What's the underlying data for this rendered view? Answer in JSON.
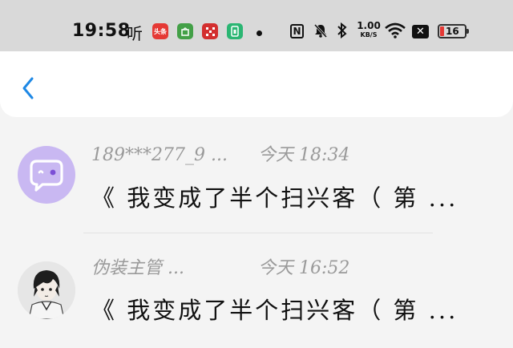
{
  "status_bar": {
    "time": "19:58",
    "ting_glyph": "听",
    "app_badge_1": "头条",
    "net_speed_value": "1.00",
    "net_speed_unit": "KB/S",
    "nfc": "N",
    "battery_level": "16",
    "icons": [
      "toutiao-icon",
      "shop-icon",
      "grid-app-icon",
      "sim-app-icon",
      "dot-icon",
      "nfc-icon",
      "mute-bell-icon",
      "bluetooth-icon",
      "wifi-icon",
      "close-box-icon",
      "battery-icon"
    ],
    "colors": {
      "battery_low": "#e53935",
      "accent": "#1e88e5"
    }
  },
  "header": {
    "back_icon": "chevron-left-icon"
  },
  "items": [
    {
      "name": "189***277_9 ...",
      "time": "今天 18:34",
      "message": "《 我变成了半个扫兴客（ 第 ...",
      "avatar": "chat-bubble-avatar"
    },
    {
      "name": "伪装主管 ...",
      "time": "今天 16:52",
      "message": "《 我变成了半个扫兴客（ 第 ...",
      "avatar": "anime-boy-avatar"
    }
  ]
}
